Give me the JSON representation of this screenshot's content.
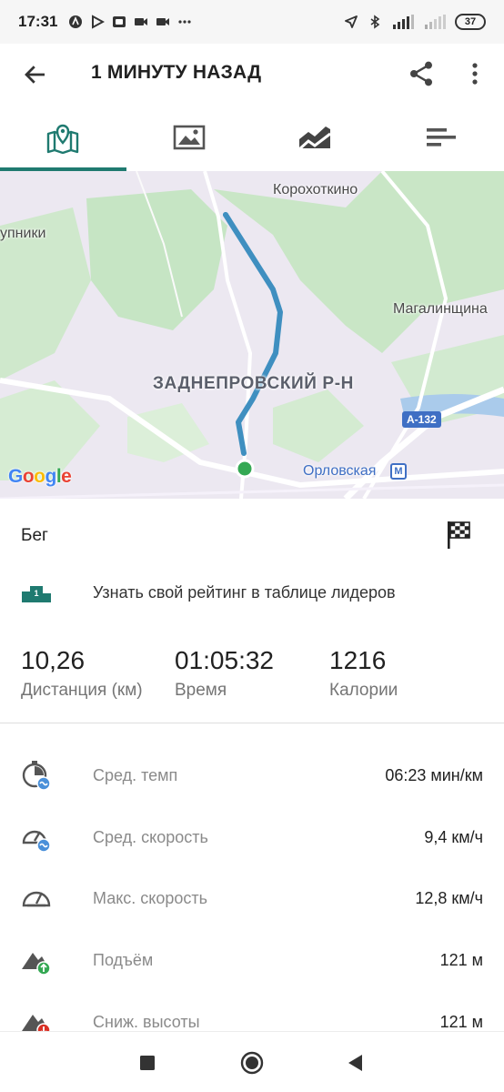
{
  "status_bar": {
    "time": "17:31",
    "battery": "37",
    "icons": [
      "location-arrow-icon",
      "bluetooth-icon",
      "signal-icon",
      "signal-weak-icon"
    ]
  },
  "app_bar": {
    "title": "1 МИНУТУ НАЗАД",
    "back_icon": "arrow-back-icon",
    "share_icon": "share-icon",
    "more_icon": "more-vert-icon"
  },
  "tabs": [
    {
      "icon": "map-pin-icon",
      "active": true
    },
    {
      "icon": "image-icon",
      "active": false
    },
    {
      "icon": "chart-area-icon",
      "active": false
    },
    {
      "icon": "list-bars-icon",
      "active": false
    }
  ],
  "map": {
    "labels": {
      "top": "Корохоткино",
      "left": "упники",
      "right": "Магалинщина",
      "district": "ЗАДНЕПРОВСКИЙ Р-Н",
      "road": "А-132",
      "metro": "Орловская",
      "google": [
        "G",
        "o",
        "o",
        "g",
        "l",
        "e"
      ]
    },
    "colors": {
      "route": "#3f8fc0",
      "end_marker": "#34a853",
      "green_area": "#c8e6c9"
    }
  },
  "activity": {
    "type": "Бег",
    "leaderboard_text": "Узнать свой рейтинг в таблице лидеров",
    "leaderboard_icon_text": "1"
  },
  "summary": [
    {
      "value": "10,26",
      "label": "Дистанция (км)"
    },
    {
      "value": "01:05:32",
      "label": "Время"
    },
    {
      "value": "1216",
      "label": "Калории"
    }
  ],
  "stats": [
    {
      "icon": "avg-pace-icon",
      "label": "Сред. темп",
      "value": "06:23 мин/км"
    },
    {
      "icon": "avg-speed-icon",
      "label": "Сред. скорость",
      "value": "9,4 км/ч"
    },
    {
      "icon": "max-speed-icon",
      "label": "Макс. скорость",
      "value": "12,8 км/ч"
    },
    {
      "icon": "elevation-gain-icon",
      "label": "Подъём",
      "value": "121 м"
    },
    {
      "icon": "elevation-loss-icon",
      "label": "Сниж. высоты",
      "value": "121 м"
    }
  ],
  "nav_bar": {
    "icons": [
      "recents-square-icon",
      "home-circle-icon",
      "back-triangle-icon"
    ]
  }
}
